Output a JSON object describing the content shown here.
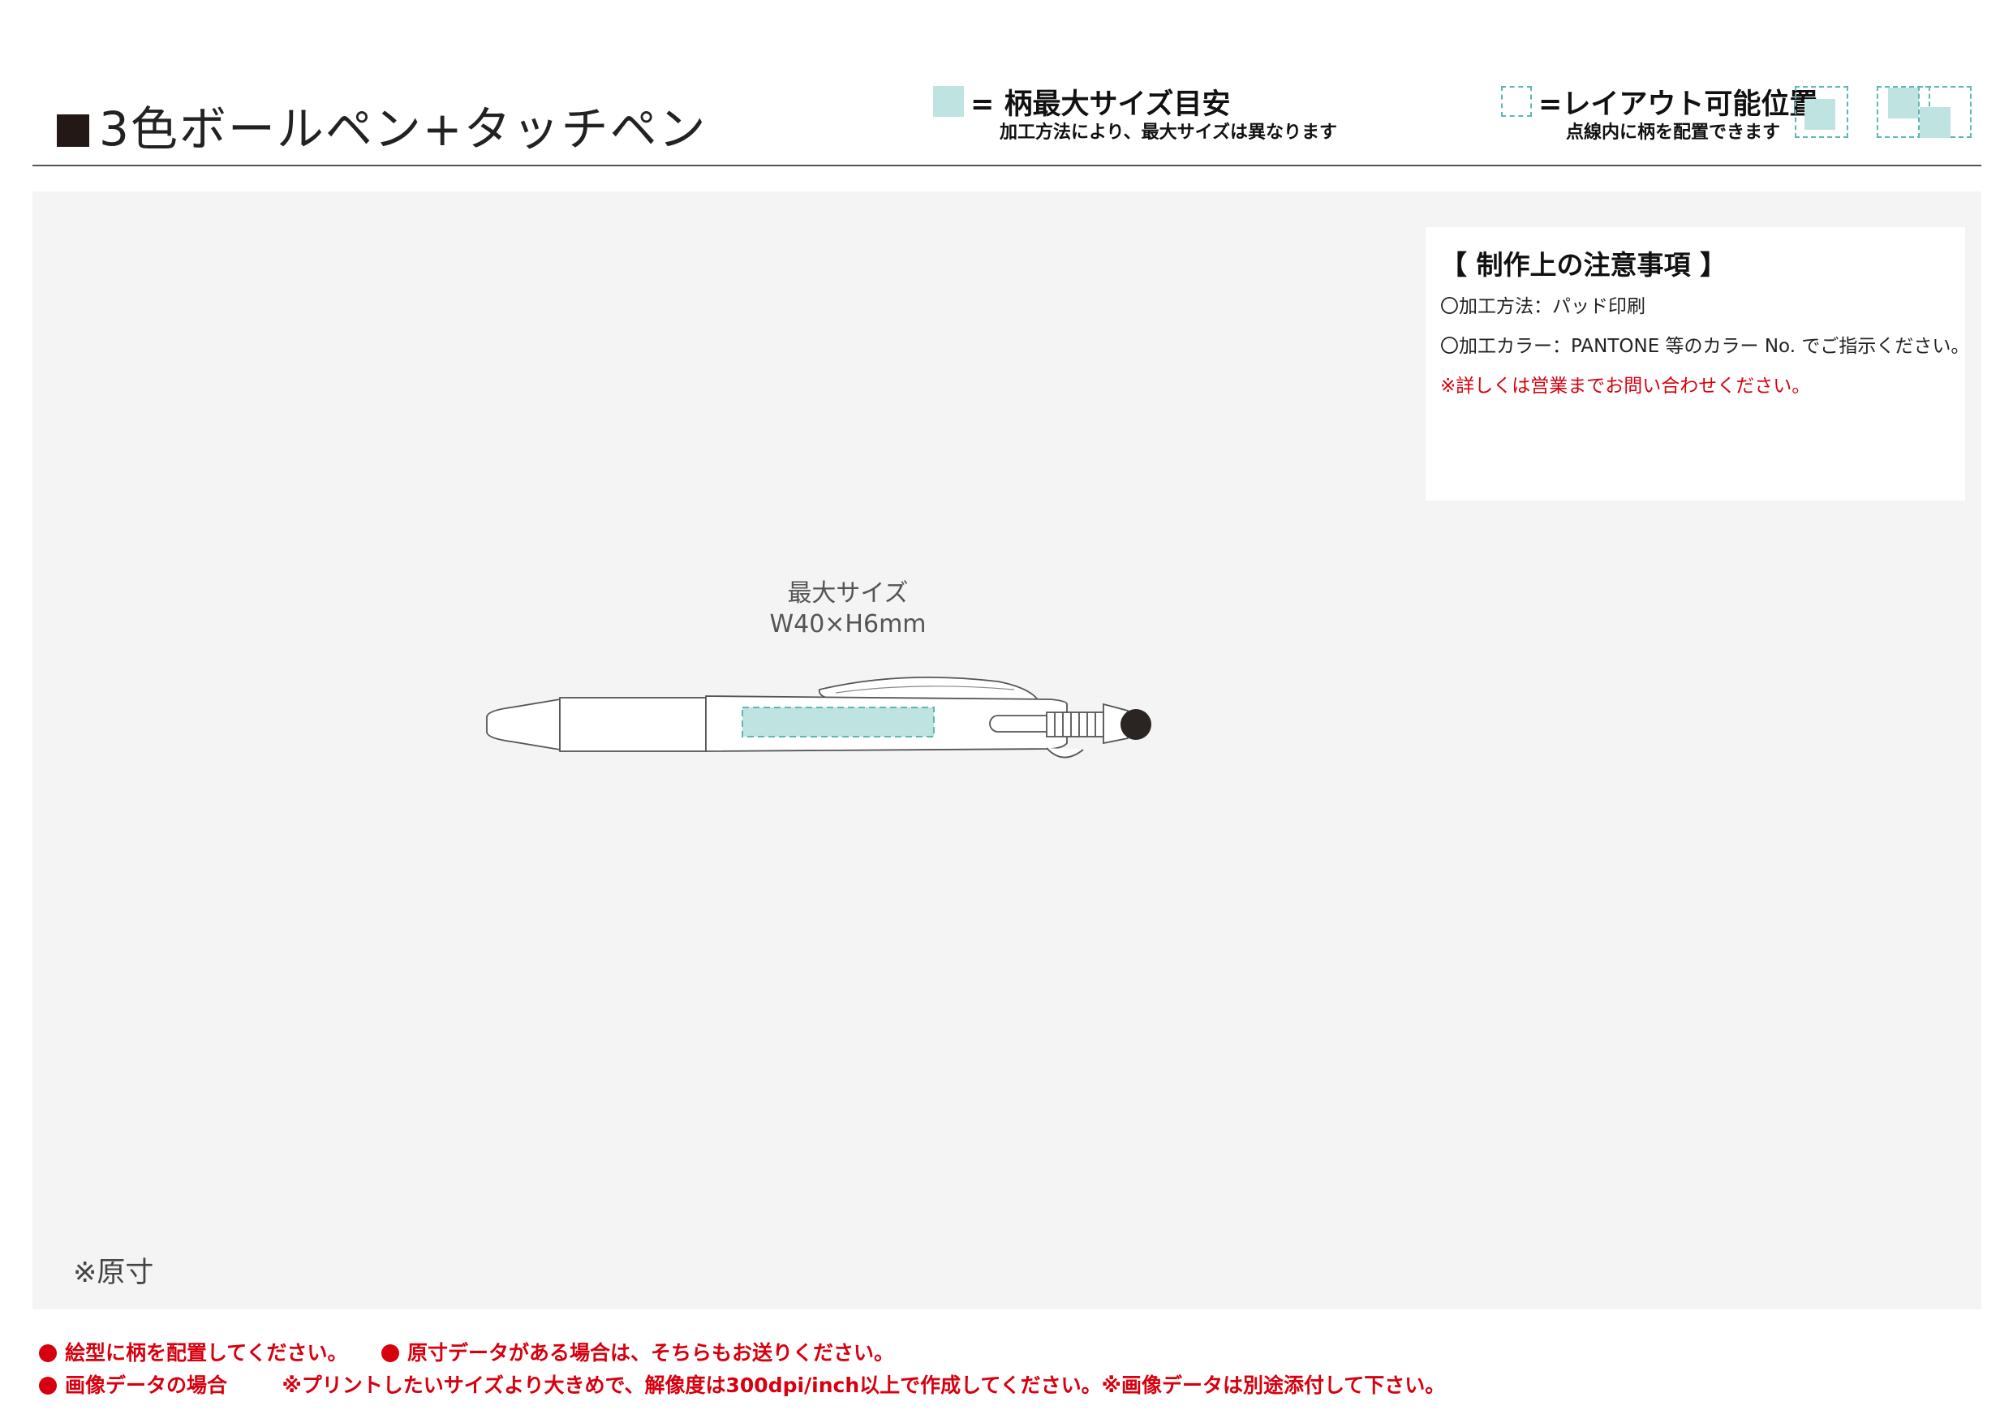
{
  "header": {
    "title": "3色ボールペン+タッチペン"
  },
  "legend": {
    "max_size_title": "= 柄最大サイズ目安",
    "max_size_sub": "加工方法により、最大サイズは異なります",
    "layout_title": "=レイアウト可能位置",
    "layout_sub": "点線内に柄を配置できます"
  },
  "notes": {
    "title": "【 制作上の注意事項 】",
    "method": "〇加工方法：パッド印刷",
    "color": "〇加工カラー：PANTONE 等のカラー No. でご指示ください。",
    "contact": "※詳しくは営業までお問い合わせください。"
  },
  "diagram": {
    "max_size_label": "最大サイズ",
    "max_size_dim": "W40×H6mm",
    "print_area_color": "#bfe3e0",
    "print_area_border": "#5fb7b3"
  },
  "scale_note": "※原寸",
  "footer": {
    "line1_a": "絵型に柄を配置してください。",
    "line1_b": "原寸データがある場合は、そちらもお送りください。",
    "line2_a": "画像データの場合",
    "line2_b": "※プリントしたいサイズより大きめで、解像度は300dpi/inch以上で作成してください。※画像データは別途添付して下さい。"
  }
}
